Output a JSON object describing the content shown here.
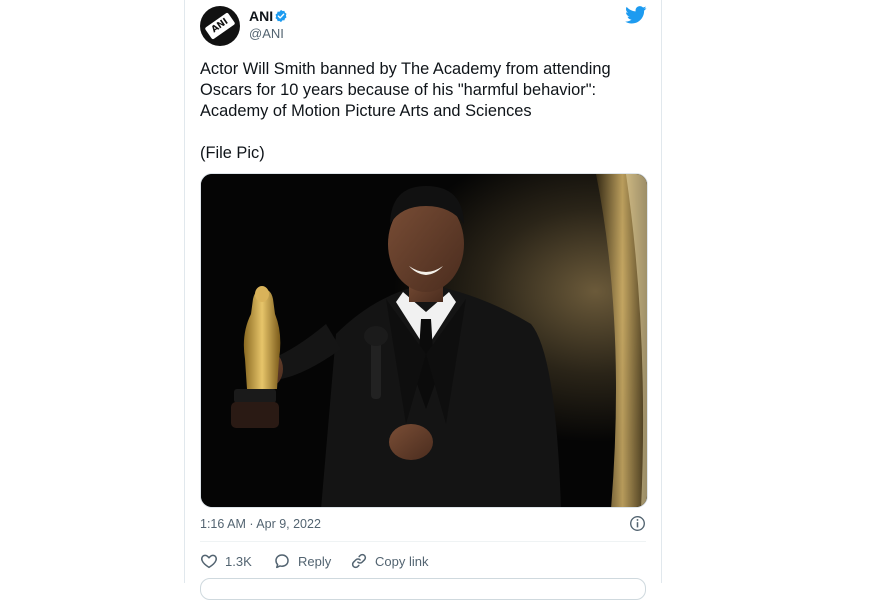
{
  "account": {
    "display_name": "ANI",
    "handle": "@ANI",
    "avatar_text": "ANI",
    "verified_icon": "verified-badge-icon",
    "verified_color": "#1d9bf0"
  },
  "tweet": {
    "text_line1": "Actor Will Smith banned by The Academy from attending Oscars for 10 years because of his \"harmful behavior\": Academy of Motion Picture Arts and Sciences",
    "text_line2": "(File Pic)",
    "timestamp": "1:16 AM · Apr 9, 2022"
  },
  "actions": {
    "like_count": "1.3K",
    "reply_label": "Reply",
    "copy_link_label": "Copy link"
  },
  "icons": {
    "twitter_logo": "twitter-bird-icon",
    "info": "info-icon",
    "like": "heart-icon",
    "reply": "speech-bubble-icon",
    "copy_link": "link-icon"
  },
  "colors": {
    "brand": "#1d9bf0",
    "text": "#0f1419",
    "muted": "#536471"
  }
}
